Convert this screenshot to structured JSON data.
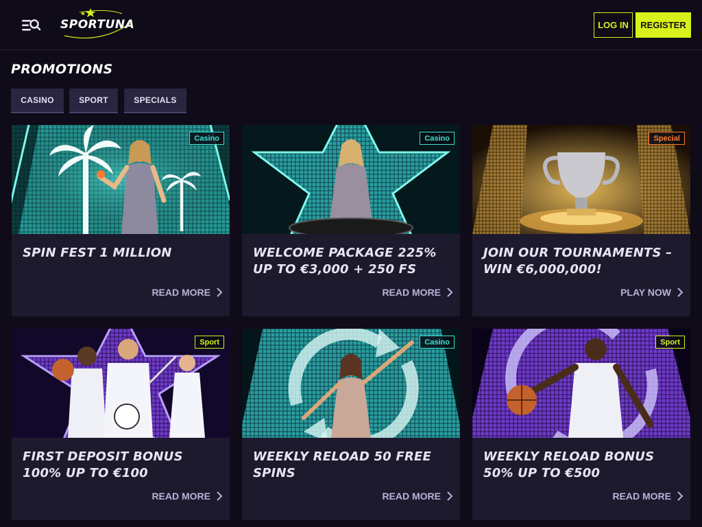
{
  "header": {
    "logo_text": "SPORTUNA",
    "login_label": "LOG IN",
    "register_label": "REGISTER",
    "menu_icon": "menu-search-icon"
  },
  "page": {
    "title": "PROMOTIONS"
  },
  "filters": [
    {
      "label": "CASINO"
    },
    {
      "label": "SPORT"
    },
    {
      "label": "SPECIALS"
    }
  ],
  "cards": [
    {
      "badge": "Casino",
      "title": "SPIN FEST 1 MILLION",
      "link": "READ MORE"
    },
    {
      "badge": "Casino",
      "title": "WELCOME PACKAGE 225% UP TO €3,000 + 250 FS",
      "link": "READ MORE"
    },
    {
      "badge": "Special",
      "title": "JOIN OUR TOURNAMENTS – WIN €6,000,000!",
      "link": "PLAY NOW"
    },
    {
      "badge": "Sport",
      "title": "FIRST DEPOSIT BONUS 100% UP TO €100",
      "link": "READ MORE"
    },
    {
      "badge": "Casino",
      "title": "WEEKLY RELOAD 50 FREE SPINS",
      "link": "READ MORE"
    },
    {
      "badge": "Sport",
      "title": "WEEKLY RELOAD BONUS 50% UP TO €500",
      "link": "READ MORE"
    }
  ],
  "colors": {
    "accent": "#d7f21a",
    "background": "#0f0b18",
    "card": "#1e1a2e",
    "casino_badge": "#3fe0d0",
    "special_badge": "#ff7a2e",
    "sport_badge": "#d7f21a"
  }
}
